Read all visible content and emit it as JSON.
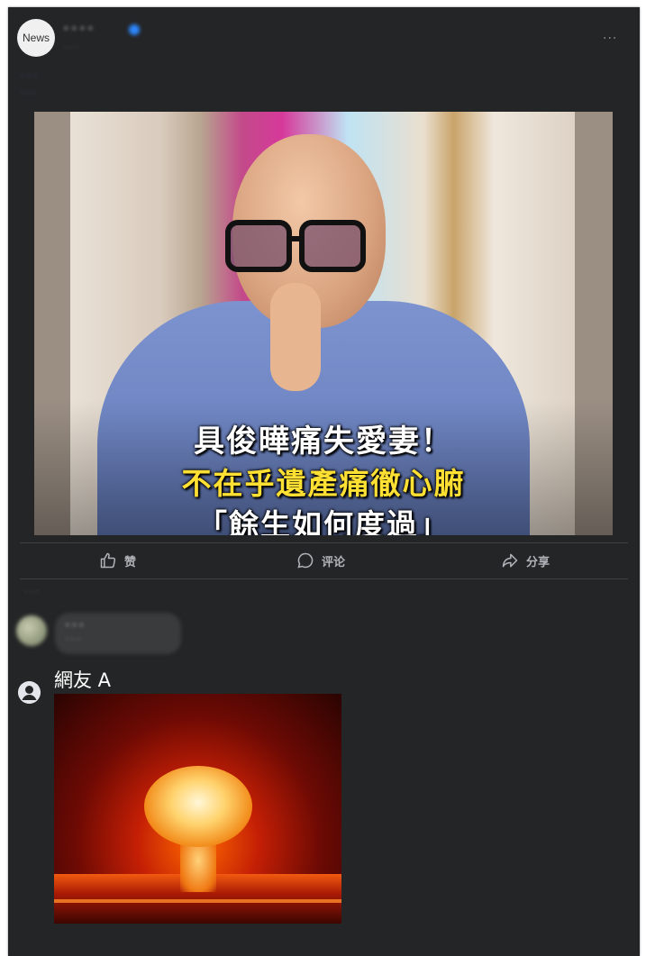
{
  "post": {
    "avatar_text": "News",
    "page_name": "‧ ‧ ‧ ‧",
    "meta": "‧ ‧ ‧",
    "more": "···",
    "caption_blurred_1": "‧ ‧ ‧",
    "caption_blurred_2": "‧ ‧ ‧",
    "image": {
      "headline_line1": "具俊曄痛失愛妻！",
      "headline_line2": "不在乎遺產痛徹心腑",
      "headline_line3": "「餘生如何度過」"
    }
  },
  "actions": {
    "like_label": "赞",
    "comment_label": "评论",
    "share_label": "分享"
  },
  "comments": {
    "sort_label": "‧ ‧ ‧",
    "first": {
      "name": "‧ ‧ ‧",
      "text": "‧ ‧ ‧"
    },
    "reply": {
      "name": "網友 A"
    }
  },
  "colors": {
    "card_bg": "#242526",
    "text_primary": "#e4e6eb",
    "text_secondary": "#b0b3b8",
    "link": "#4599ff",
    "headline_yellow": "#ffe033"
  }
}
